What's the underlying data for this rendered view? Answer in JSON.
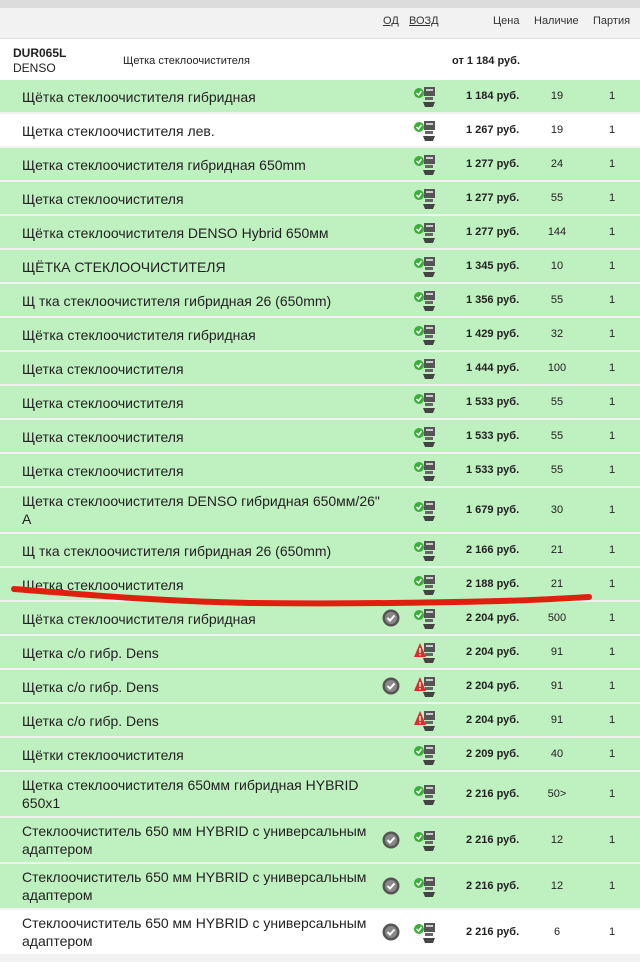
{
  "header": {
    "od": "ОД",
    "vozd": "ВОЗД",
    "price": "Цена",
    "stock": "Наличие",
    "lot": "Партия"
  },
  "product": {
    "code": "DUR065L",
    "brand": "DENSO",
    "name": "Щетка стеклоочистителя",
    "price_from": "от 1 184 руб."
  },
  "colors": {
    "row_green": "#bff0bf",
    "row_white": "#ffffff",
    "annotation_red": "#e0200f"
  },
  "icons": {
    "delivery": "delivery-truck-icon",
    "delivery_warning": "delivery-warning-icon",
    "od": "od-badge-icon"
  },
  "rows": [
    {
      "name": "Щётка стеклоочистителя гибридная",
      "price": "1 184 руб.",
      "stock": "19",
      "lot": "1"
    },
    {
      "name": "Щетка стеклоочистителя лев.",
      "price": "1 267 руб.",
      "stock": "19",
      "lot": "1"
    },
    {
      "name": "Щетка стеклоочистителя гибридная 650mm",
      "price": "1 277 руб.",
      "stock": "24",
      "lot": "1"
    },
    {
      "name": "Щетка стеклоочистителя",
      "price": "1 277 руб.",
      "stock": "55",
      "lot": "1"
    },
    {
      "name": "Щётка стеклоочистителя DENSO Hybrid 650мм",
      "price": "1 277 руб.",
      "stock": "144",
      "lot": "1"
    },
    {
      "name": "ЩЁТКА СТЕКЛООЧИСТИТЕЛЯ",
      "price": "1 345 руб.",
      "stock": "10",
      "lot": "1"
    },
    {
      "name": "Щ тка стеклоочистителя гибридная 26 (650mm)",
      "price": "1 356 руб.",
      "stock": "55",
      "lot": "1"
    },
    {
      "name": "Щётка стеклоочистителя гибридная",
      "price": "1 429 руб.",
      "stock": "32",
      "lot": "1"
    },
    {
      "name": "Щетка стеклоочистителя",
      "price": "1 444 руб.",
      "stock": "100",
      "lot": "1"
    },
    {
      "name": "Щетка стеклоочистителя",
      "price": "1 533 руб.",
      "stock": "55",
      "lot": "1"
    },
    {
      "name": "Щетка стеклоочистителя",
      "price": "1 533 руб.",
      "stock": "55",
      "lot": "1"
    },
    {
      "name": "Щетка стеклоочистителя",
      "price": "1 533 руб.",
      "stock": "55",
      "lot": "1"
    },
    {
      "name": "Щетка стеклоочистителя DENSO гибридная 650мм/26\" A",
      "price": "1 679 руб.",
      "stock": "30",
      "lot": "1"
    },
    {
      "name": "Щ тка стеклоочистителя гибридная 26 (650mm)",
      "price": "2 166 руб.",
      "stock": "21",
      "lot": "1"
    },
    {
      "name": "Щетка стеклоочистителя",
      "price": "2 188 руб.",
      "stock": "21",
      "lot": "1"
    },
    {
      "name": "Щётка стеклоочистителя гибридная",
      "price": "2 204 руб.",
      "stock": "500",
      "lot": "1"
    },
    {
      "name": "Щетка с/о гибр. Dens",
      "price": "2 204 руб.",
      "stock": "91",
      "lot": "1"
    },
    {
      "name": "Щетка с/о гибр. Dens",
      "price": "2 204 руб.",
      "stock": "91",
      "lot": "1"
    },
    {
      "name": "Щетка с/о гибр. Dens",
      "price": "2 204 руб.",
      "stock": "91",
      "lot": "1"
    },
    {
      "name": "Щётки стеклоочистителя",
      "price": "2 209 руб.",
      "stock": "40",
      "lot": "1"
    },
    {
      "name": "Щетка стеклоочистителя 650мм гибридная HYBRID 650x1",
      "price": "2 216 руб.",
      "stock": "50>",
      "lot": "1"
    },
    {
      "name": "Стеклоочиститель 650 мм HYBRID с универсальным адаптером",
      "price": "2 216 руб.",
      "stock": "12",
      "lot": "1"
    },
    {
      "name": "Стеклоочиститель 650 мм HYBRID с универсальным адаптером",
      "price": "2 216 руб.",
      "stock": "12",
      "lot": "1"
    },
    {
      "name": "Стеклоочиститель 650 мм HYBRID с универсальным адаптером",
      "price": "2 216 руб.",
      "stock": "6",
      "lot": "1"
    }
  ]
}
